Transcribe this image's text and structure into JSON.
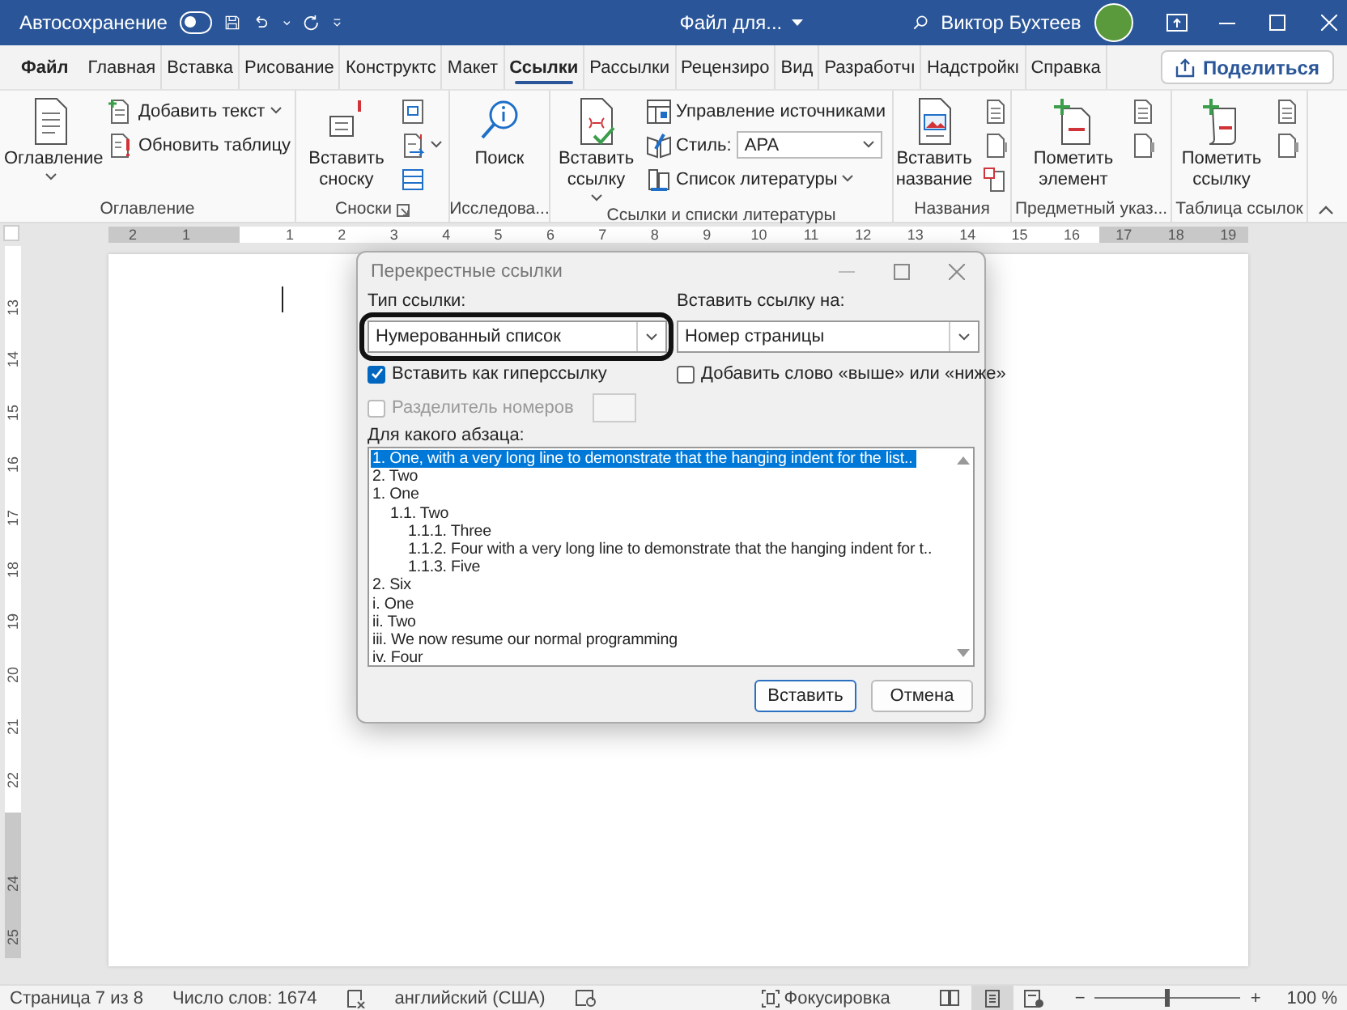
{
  "title_bar": {
    "autosave_label": "Автосохранение",
    "autosave_on": false,
    "file_title": "Файл для...",
    "user_name": "Виктор Бухтеев"
  },
  "tabs": [
    {
      "label": "Файл",
      "selected": false
    },
    {
      "label": "Главная",
      "selected": false
    },
    {
      "label": "Вставка",
      "selected": false
    },
    {
      "label": "Рисование",
      "selected": false
    },
    {
      "label": "Конструктс",
      "selected": false
    },
    {
      "label": "Макет",
      "selected": false
    },
    {
      "label": "Ссылки",
      "selected": true
    },
    {
      "label": "Рассылки",
      "selected": false
    },
    {
      "label": "Рецензиро",
      "selected": false
    },
    {
      "label": "Вид",
      "selected": false
    },
    {
      "label": "Разработчı",
      "selected": false
    },
    {
      "label": "Надстройкı",
      "selected": false
    },
    {
      "label": "Справка",
      "selected": false
    }
  ],
  "share_button": "Поделиться",
  "ribbon_groups": [
    {
      "label": "Оглавление",
      "launcher": false,
      "items": [
        {
          "kind": "large",
          "label": "Оглавление",
          "caret": true
        },
        {
          "kind": "stack",
          "items": [
            {
              "kind": "small",
              "label": "Добавить текст",
              "caret": true
            },
            {
              "kind": "small",
              "label": "Обновить таблицу",
              "caret": false
            }
          ]
        }
      ]
    },
    {
      "label": "Сноски",
      "launcher": true,
      "items": [
        {
          "kind": "large",
          "label": "Вставить сноску",
          "caret": false
        },
        {
          "kind": "stack",
          "items": [
            {
              "kind": "small",
              "caret": false
            },
            {
              "kind": "small",
              "caret": true
            },
            {
              "kind": "small",
              "caret": false
            }
          ]
        }
      ]
    },
    {
      "label": "Исследова...",
      "launcher": false,
      "items": [
        {
          "kind": "large",
          "label": "Поиск",
          "caret": false
        }
      ]
    },
    {
      "label": "Ссылки и списки литературы",
      "launcher": false,
      "items": [
        {
          "kind": "large",
          "label": "Вставить ссылку",
          "caret": true
        },
        {
          "kind": "stack",
          "items": [
            {
              "kind": "small",
              "label": "Управление источниками",
              "caret": false
            },
            {
              "kind": "style",
              "label": "Стиль:",
              "value": "APA"
            },
            {
              "kind": "small",
              "label": "Список литературы",
              "caret": true
            }
          ]
        }
      ]
    },
    {
      "label": "Названия",
      "launcher": false,
      "items": [
        {
          "kind": "large",
          "label": "Вставить название",
          "caret": false
        },
        {
          "kind": "stack",
          "items": [
            {
              "kind": "small",
              "caret": false
            },
            {
              "kind": "small",
              "caret": false
            },
            {
              "kind": "small",
              "caret": false
            }
          ]
        }
      ]
    },
    {
      "label": "Предметный указ...",
      "launcher": false,
      "items": [
        {
          "kind": "large",
          "label": "Пометить элемент",
          "caret": false
        },
        {
          "kind": "stack",
          "items": [
            {
              "kind": "small",
              "caret": false
            },
            {
              "kind": "small",
              "caret": false
            }
          ]
        }
      ]
    },
    {
      "label": "Таблица ссылок",
      "launcher": false,
      "items": [
        {
          "kind": "large",
          "label": "Пометить ссылку",
          "caret": false
        },
        {
          "kind": "stack",
          "items": [
            {
              "kind": "small",
              "caret": false
            },
            {
              "kind": "small",
              "caret": false
            }
          ]
        }
      ]
    }
  ],
  "horizontal_ruler": {
    "labels": [
      "2",
      "1",
      "1",
      "2",
      "3",
      "4",
      "5",
      "6",
      "7",
      "8",
      "9",
      "10",
      "11",
      "12",
      "13",
      "14",
      "15",
      "16",
      "17",
      "18",
      "19"
    ]
  },
  "vertical_ruler": {
    "labels": [
      "13",
      "14",
      "15",
      "16",
      "17",
      "18",
      "19",
      "20",
      "21",
      "22",
      "24",
      "25"
    ]
  },
  "dialog": {
    "title": "Перекрестные ссылки",
    "reference_type": {
      "label": "Тип ссылки:",
      "value": "Нумерованный список",
      "highlighted": true
    },
    "insert_reference_to": {
      "label": "Вставить ссылку на:",
      "value": "Номер страницы"
    },
    "hyperlink_checkbox": {
      "label": "Вставить как гиперссылку",
      "checked": true
    },
    "above_below_checkbox": {
      "label": "Добавить слово «выше» или «ниже»",
      "checked": false
    },
    "separator_checkbox": {
      "label": "Разделитель номеров",
      "checked": false,
      "disabled": true
    },
    "list_label": "Для какого абзаца:",
    "paragraphs": [
      {
        "text": "1. One, with a very long line to demonstrate that the hanging indent for the list..",
        "selected": true
      },
      {
        "text": "2. Two",
        "selected": false
      },
      {
        "text": "1. One",
        "selected": false,
        "children": [
          {
            "text": "1.1. Two",
            "selected": false,
            "children": [
              {
                "text": "1.1.1. Three",
                "selected": false
              },
              {
                "text": "1.1.2. Four with a very long line to demonstrate that the hanging indent for t..",
                "selected": false
              },
              {
                "text": "1.1.3. Five",
                "selected": false
              }
            ]
          }
        ]
      },
      {
        "text": "2. Six",
        "selected": false
      },
      {
        "text": "i. One",
        "selected": false
      },
      {
        "text": "ii. Two",
        "selected": false
      },
      {
        "text": "iii. We now resume our normal programming",
        "selected": false
      },
      {
        "text": "iv. Four",
        "selected": false
      }
    ],
    "buttons": [
      {
        "label": "Вставить",
        "default": true
      },
      {
        "label": "Отмена",
        "default": false
      }
    ]
  },
  "status_bar": {
    "page": "Страница 7 из 8",
    "words": "Число слов: 1674",
    "language": "английский (США)",
    "focus": "Фокусировка",
    "views": [
      {
        "selected": false
      },
      {
        "selected": true
      },
      {
        "selected": false
      }
    ],
    "zoom_out": "−",
    "zoom_in": "+",
    "zoom": {
      "level": 0.5
    },
    "zoom_reading": "100 %"
  }
}
